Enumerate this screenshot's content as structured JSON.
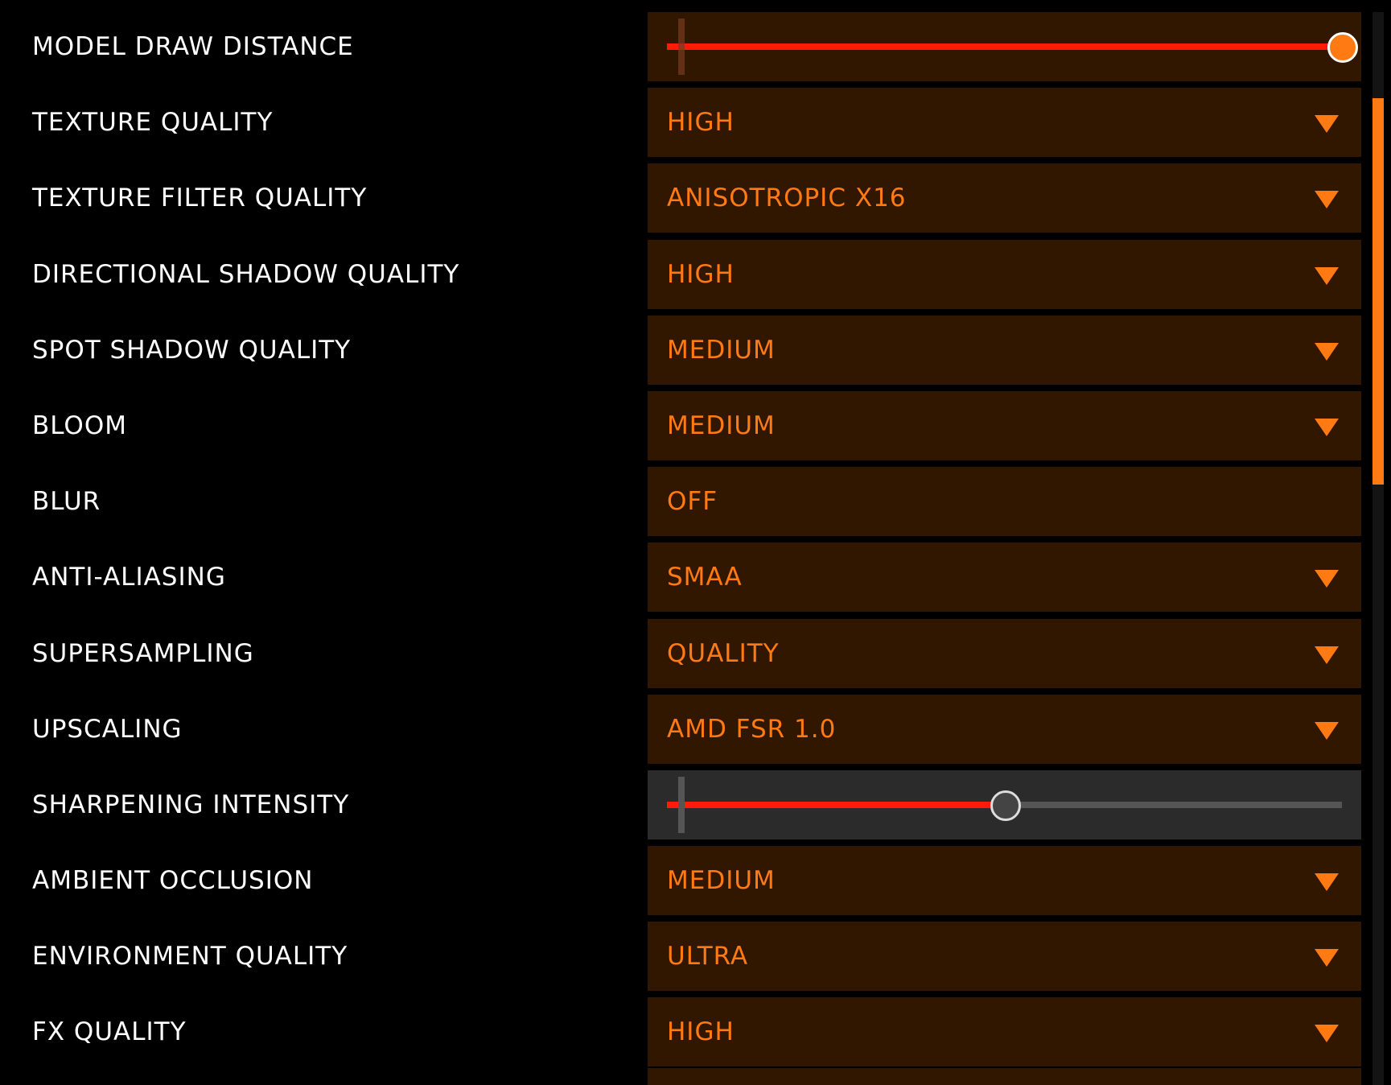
{
  "settings": [
    {
      "label": "MODEL DRAW DISTANCE",
      "type": "slider",
      "level": 1.0
    },
    {
      "label": "TEXTURE QUALITY",
      "type": "dropdown",
      "value": "HIGH"
    },
    {
      "label": "TEXTURE FILTER QUALITY",
      "type": "dropdown",
      "value": "ANISOTROPIC X16"
    },
    {
      "label": "DIRECTIONAL SHADOW QUALITY",
      "type": "dropdown",
      "value": "HIGH"
    },
    {
      "label": "SPOT SHADOW QUALITY",
      "type": "dropdown",
      "value": "MEDIUM"
    },
    {
      "label": "BLOOM",
      "type": "dropdown",
      "value": "MEDIUM"
    },
    {
      "label": "BLUR",
      "type": "toggle",
      "value": "OFF"
    },
    {
      "label": "ANTI-ALIASING",
      "type": "dropdown",
      "value": "SMAA"
    },
    {
      "label": "SUPERSAMPLING",
      "type": "dropdown",
      "value": "QUALITY"
    },
    {
      "label": "UPSCALING",
      "type": "dropdown",
      "value": "AMD FSR 1.0"
    },
    {
      "label": "SHARPENING INTENSITY",
      "type": "slider",
      "level": 0.5,
      "disabled": true
    },
    {
      "label": "AMBIENT OCCLUSION",
      "type": "dropdown",
      "value": "MEDIUM"
    },
    {
      "label": "ENVIRONMENT QUALITY",
      "type": "dropdown",
      "value": "ULTRA"
    },
    {
      "label": "FX QUALITY",
      "type": "dropdown",
      "value": "HIGH"
    }
  ],
  "scrollbar": {
    "position": 0.08,
    "visible_fraction": 0.36
  },
  "colors": {
    "accent": "#ff7a12",
    "slider_fill": "#ff1a0a",
    "control_bg": "#311600",
    "disabled_bg": "#2b2b2b"
  }
}
